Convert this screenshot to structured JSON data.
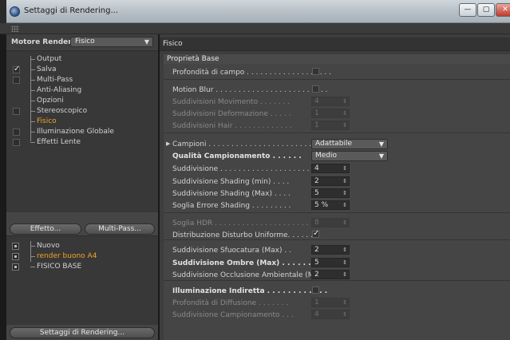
{
  "window": {
    "title": "Settaggi di Rendering...",
    "controls": {
      "minimize": "—",
      "maximize": "▢",
      "close": "✕"
    }
  },
  "left": {
    "engine_label": "Motore Render",
    "engine_value": "Fisico",
    "tree": [
      {
        "label": "Output",
        "checkbox": false,
        "checked": false,
        "active": false
      },
      {
        "label": "Salva",
        "checkbox": true,
        "checked": true,
        "active": false
      },
      {
        "label": "Multi-Pass",
        "checkbox": true,
        "checked": false,
        "active": false
      },
      {
        "label": "Anti-Aliasing",
        "checkbox": false,
        "checked": false,
        "active": false
      },
      {
        "label": "Opzioni",
        "checkbox": false,
        "checked": false,
        "active": false
      },
      {
        "label": "Stereoscopico",
        "checkbox": true,
        "checked": false,
        "active": false
      },
      {
        "label": "Fisico",
        "checkbox": false,
        "checked": false,
        "active": true
      },
      {
        "label": "Illuminazione Globale",
        "checkbox": true,
        "checked": false,
        "active": false
      },
      {
        "label": "Effetti Lente",
        "checkbox": true,
        "checked": false,
        "active": false
      }
    ],
    "effect_button": "Effetto...",
    "multipass_button": "Multi-Pass...",
    "presets": [
      {
        "label": "Nuovo",
        "active": false
      },
      {
        "label": "render buono A4",
        "active": true
      },
      {
        "label": "FISICO BASE",
        "active": false
      }
    ],
    "footer_button": "Settaggi di Rendering..."
  },
  "right": {
    "header": "Fisico",
    "group": "Proprietà Base",
    "props": [
      {
        "label": "Profondità di campo . . . . . . . . . . . . . . . . . . .",
        "type": "check",
        "checked": false,
        "bold": false,
        "dim": false
      },
      {
        "label": "Motion Blur . . . . . . . . . . . . . . . . . . . . . . . . .",
        "type": "check",
        "checked": false,
        "bold": false,
        "dim": false
      },
      {
        "label": "Suddivisioni Movimento . . . . . . .",
        "type": "num",
        "value": "4",
        "bold": false,
        "dim": true
      },
      {
        "label": "Suddivisioni Deformazione . . . . .",
        "type": "num",
        "value": "1",
        "bold": false,
        "dim": true
      },
      {
        "label": "Suddivisioni Hair . . . . . . . . . . . . .",
        "type": "num",
        "value": "1",
        "bold": false,
        "dim": true
      },
      {
        "label": "Campioni . . . . . . . . . . . . . . . . . . . . . . . . . . .",
        "type": "dropdown",
        "value": "Adattabile",
        "bold": false,
        "dim": false,
        "tri": true
      },
      {
        "label": "Qualità Campionamento . . . . . .",
        "type": "dropdown",
        "value": "Medio",
        "bold": true,
        "dim": false
      },
      {
        "label": "Suddivisione . . . . . . . . . . . . . . . . . . . . . .",
        "type": "num",
        "value": "4",
        "bold": false,
        "dim": false
      },
      {
        "label": "Suddivisione Shading (min) . . . .",
        "type": "num",
        "value": "2",
        "bold": false,
        "dim": false
      },
      {
        "label": "Suddivisione Shading (Max) . . . .",
        "type": "num",
        "value": "5",
        "bold": false,
        "dim": false
      },
      {
        "label": "Soglia Errore Shading . . . . . . . . .",
        "type": "num",
        "value": "5 %",
        "bold": false,
        "dim": false
      },
      {
        "label": "Soglia HDR . . . . . . . . . . . . . . . . . . . . . . .",
        "type": "num",
        "value": "8",
        "bold": false,
        "dim": true
      },
      {
        "label": "Distribuzione Disturbo Uniforme. . . . . . .",
        "type": "check",
        "checked": true,
        "bold": false,
        "dim": false
      },
      {
        "label": "Suddivisione Sfuocatura (Max) . .",
        "type": "num",
        "value": "2",
        "bold": false,
        "dim": false
      },
      {
        "label": "Suddivisione Ombre (Max) . . . . . .",
        "type": "num",
        "value": "5",
        "bold": true,
        "dim": false
      },
      {
        "label": "Suddivisione Occlusione Ambientale (Max)",
        "type": "num",
        "value": "2",
        "bold": false,
        "dim": false
      },
      {
        "label": "Illuminazione Indiretta . . . . . . . . . . . .",
        "type": "check",
        "checked": false,
        "bold": true,
        "dim": false
      },
      {
        "label": "Profondità di Diffusione . . . . . . .",
        "type": "num",
        "value": "1",
        "bold": false,
        "dim": true
      },
      {
        "label": "Suddivisione Campionamento . . .",
        "type": "num",
        "value": "4",
        "bold": false,
        "dim": true
      }
    ]
  },
  "icons": {
    "checkmark": "✓",
    "spinner": "⇕",
    "dropdown_arrow": "▼",
    "expand_triangle": "▶"
  },
  "colors": {
    "accent": "#f0a329",
    "panel": "#454545",
    "background": "#3d3d3d"
  }
}
